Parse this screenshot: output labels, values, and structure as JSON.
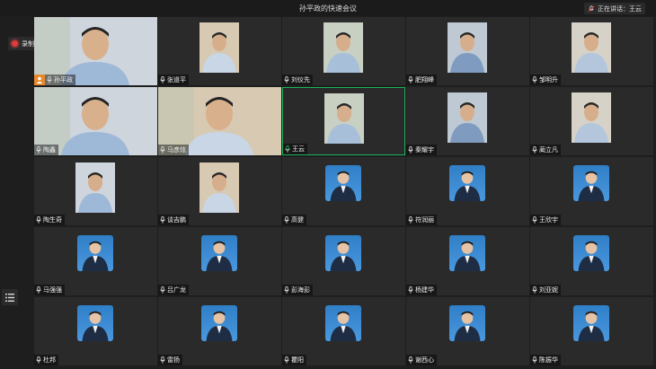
{
  "meeting": {
    "title": "孙平政的快速会议",
    "speaking": "正在讲话：王云",
    "recording": "录制中"
  },
  "colors": {
    "background": "#1e1e1e",
    "tile": "#2a2a2a",
    "active_border": "#19b35b",
    "recording_dot": "#e23b3b",
    "host_badge": "#e8892c",
    "avatar_blue": "#3a8bd4"
  },
  "participants": [
    {
      "name": "孙平政",
      "video": "wide",
      "host": true
    },
    {
      "name": "张道平",
      "video": "portrait"
    },
    {
      "name": "刘仪先",
      "video": "portrait"
    },
    {
      "name": "肥翔峰",
      "video": "portrait"
    },
    {
      "name": "邹明升",
      "video": "portrait"
    },
    {
      "name": "陶鑫",
      "video": "wide"
    },
    {
      "name": "马彦炫",
      "video": "wide"
    },
    {
      "name": "王云",
      "video": "portrait",
      "active": true
    },
    {
      "name": "秦耀宇",
      "video": "portrait"
    },
    {
      "name": "蔺立凡",
      "video": "portrait"
    },
    {
      "name": "陶生奇",
      "video": "portrait"
    },
    {
      "name": "谈吉鹏",
      "video": "portrait"
    },
    {
      "name": "高健",
      "video": "avatar"
    },
    {
      "name": "符润丽",
      "video": "avatar"
    },
    {
      "name": "王欣宇",
      "video": "avatar"
    },
    {
      "name": "马强强",
      "video": "avatar"
    },
    {
      "name": "吕广龙",
      "video": "avatar"
    },
    {
      "name": "彭海彭",
      "video": "avatar"
    },
    {
      "name": "杨建华",
      "video": "avatar"
    },
    {
      "name": "刘亚妮",
      "video": "avatar"
    },
    {
      "name": "杜邦",
      "video": "avatar"
    },
    {
      "name": "雷扬",
      "video": "avatar"
    },
    {
      "name": "瞿阳",
      "video": "avatar"
    },
    {
      "name": "谢西心",
      "video": "avatar"
    },
    {
      "name": "陈振华",
      "video": "avatar"
    }
  ]
}
